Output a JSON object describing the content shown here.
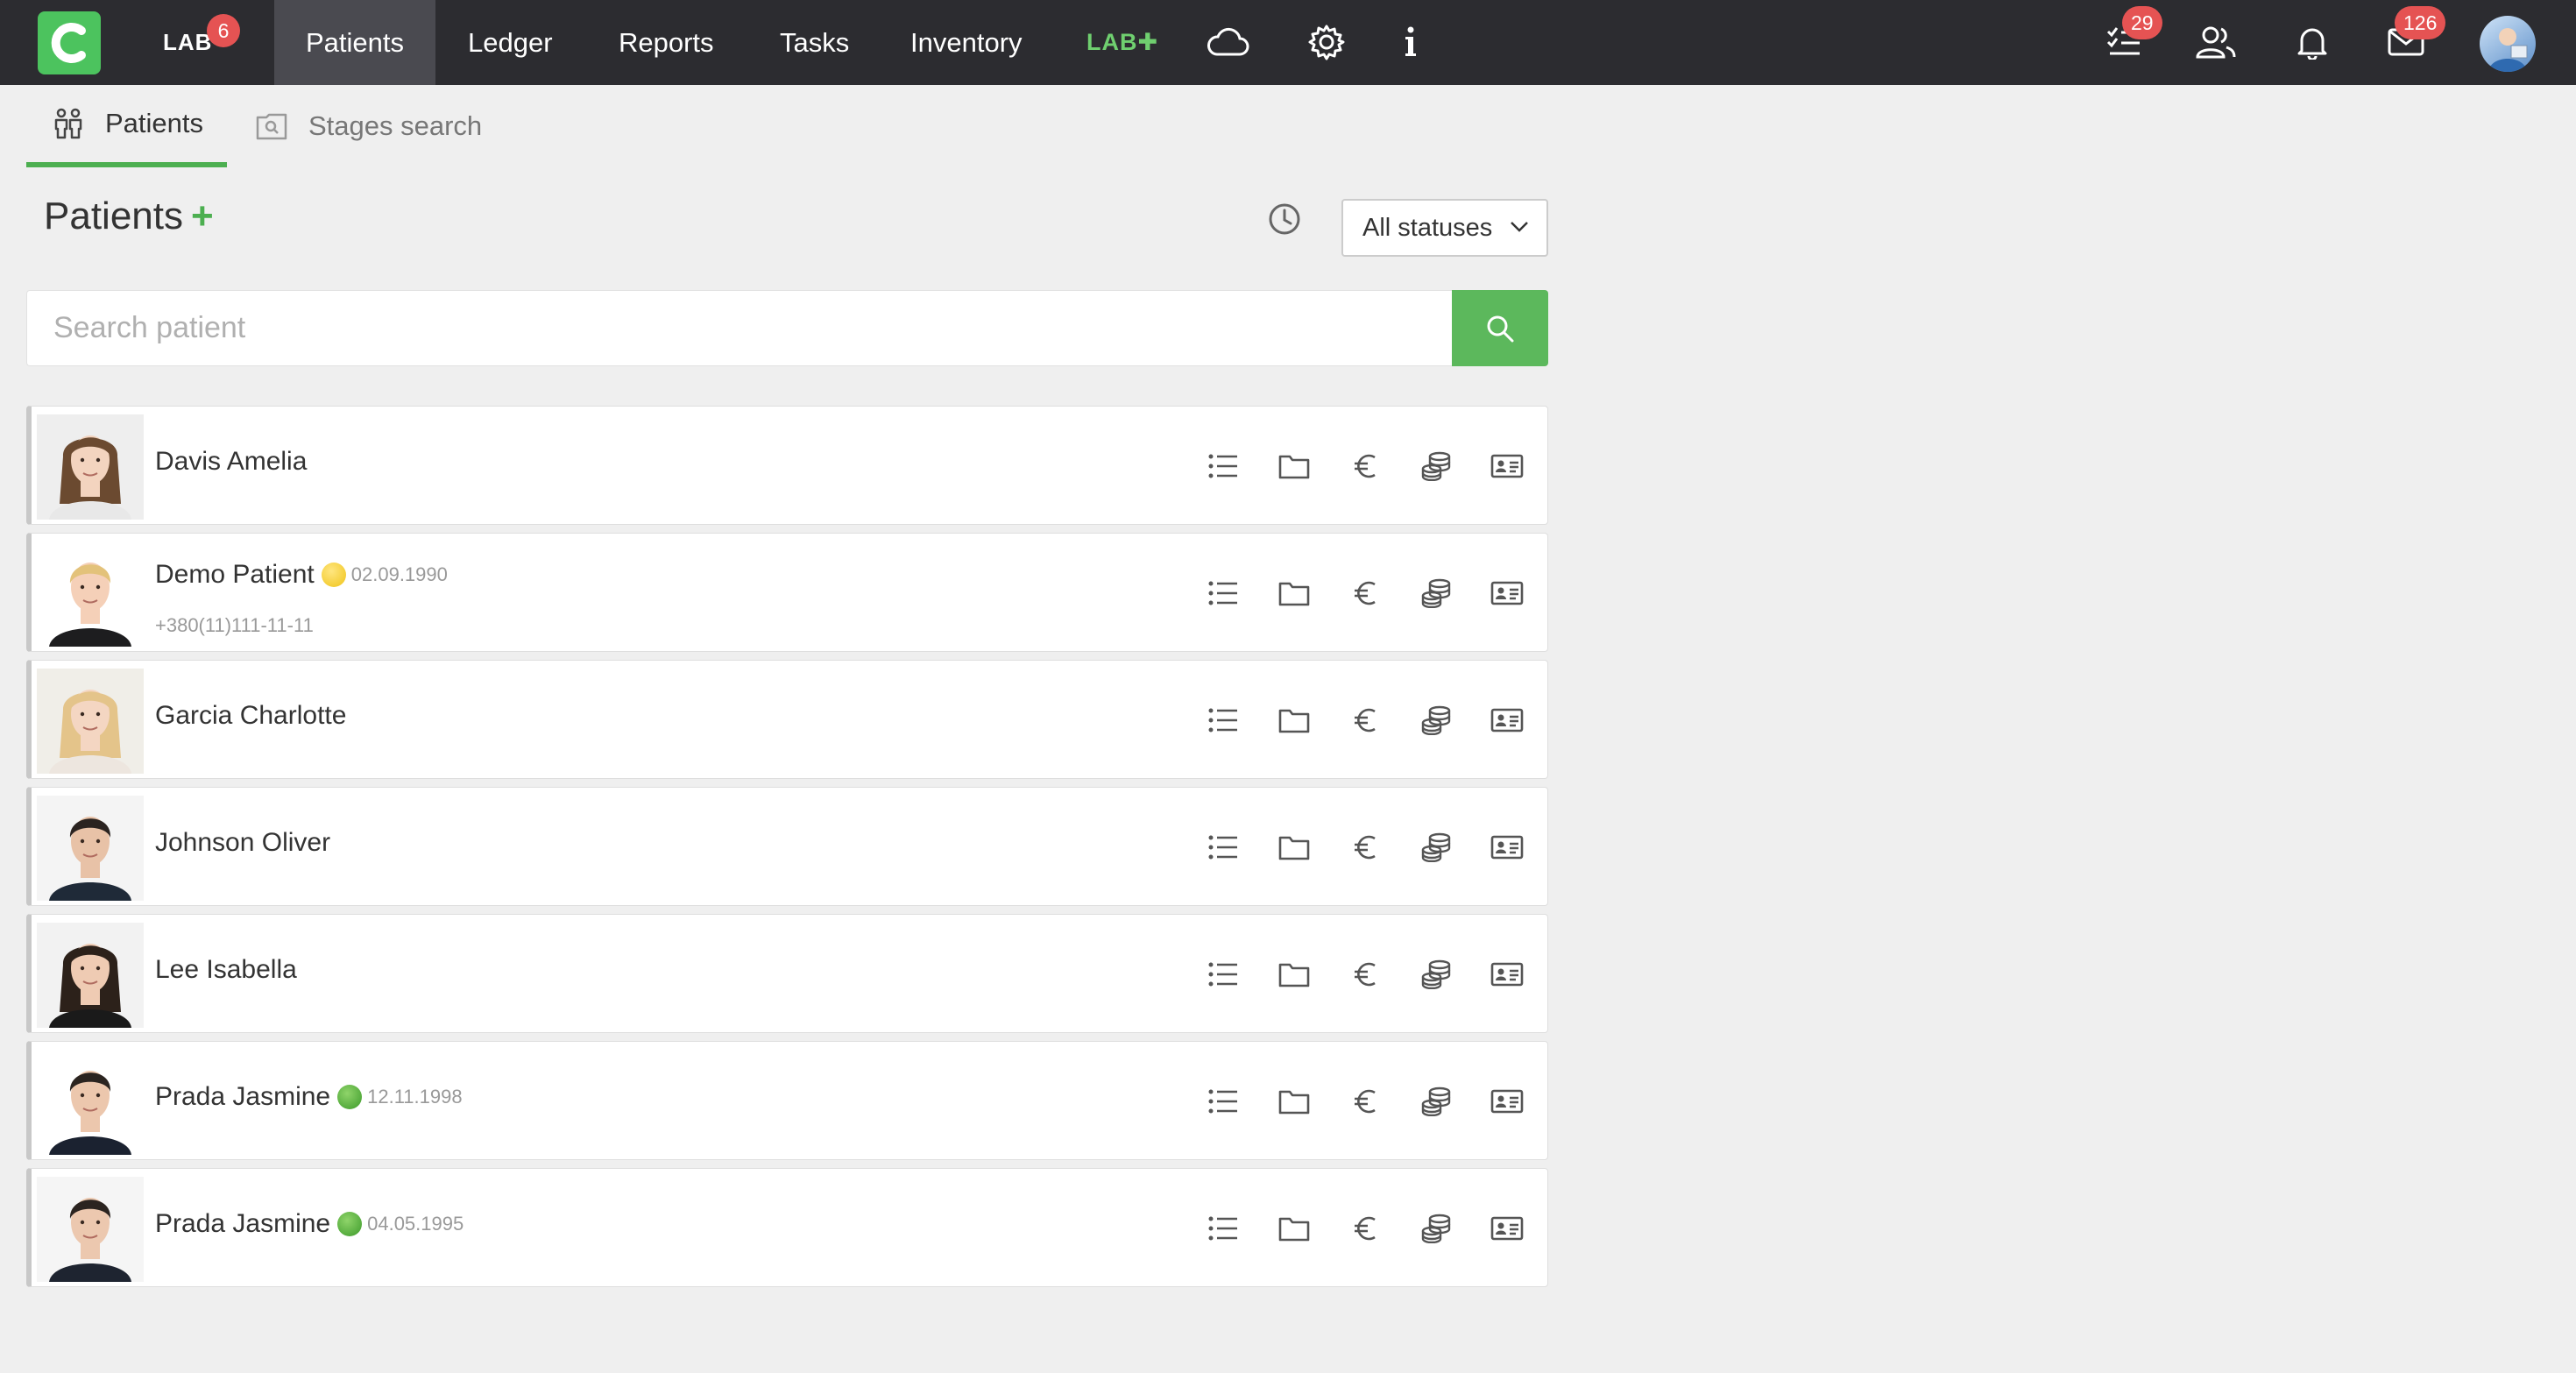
{
  "nav": {
    "lab_label": "LAB",
    "lab_badge": "6",
    "items": [
      "Patients",
      "Ledger",
      "Reports",
      "Tasks",
      "Inventory"
    ],
    "lab_plus": "LAB✚",
    "tasks_badge": "29",
    "mail_badge": "126",
    "accent": "#4cc35e"
  },
  "subtabs": {
    "patients": "Patients",
    "stages_search": "Stages search"
  },
  "page": {
    "title": "Patients",
    "add_symbol": "+",
    "status_filter": "All statuses",
    "search_placeholder": "Search patient"
  },
  "patients": [
    {
      "name": "Davis Amelia",
      "status_dot": "",
      "dob": "",
      "phone": ""
    },
    {
      "name": "Demo Patient",
      "status_dot": "yellow",
      "dob": "02.09.1990",
      "phone": "+380(11)111-11-11"
    },
    {
      "name": "Garcia Charlotte",
      "status_dot": "",
      "dob": "",
      "phone": ""
    },
    {
      "name": "Johnson Oliver",
      "status_dot": "",
      "dob": "",
      "phone": ""
    },
    {
      "name": "Lee Isabella",
      "status_dot": "",
      "dob": "",
      "phone": ""
    },
    {
      "name": "Prada Jasmine",
      "status_dot": "green",
      "dob": "12.11.1998",
      "phone": ""
    },
    {
      "name": "Prada Jasmine",
      "status_dot": "green",
      "dob": "04.05.1995",
      "phone": ""
    }
  ],
  "row_actions": [
    "list-icon",
    "folder-icon",
    "euro-icon",
    "coins-icon",
    "id-card-icon"
  ]
}
